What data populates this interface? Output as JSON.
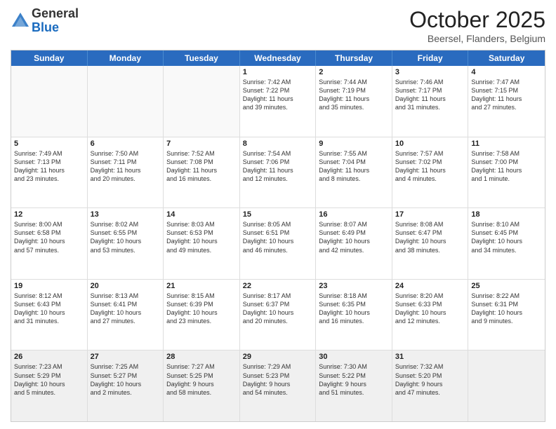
{
  "logo": {
    "general": "General",
    "blue": "Blue"
  },
  "title": "October 2025",
  "location": "Beersel, Flanders, Belgium",
  "days": [
    "Sunday",
    "Monday",
    "Tuesday",
    "Wednesday",
    "Thursday",
    "Friday",
    "Saturday"
  ],
  "weeks": [
    [
      {
        "day": "",
        "info": ""
      },
      {
        "day": "",
        "info": ""
      },
      {
        "day": "",
        "info": ""
      },
      {
        "day": "1",
        "info": "Sunrise: 7:42 AM\nSunset: 7:22 PM\nDaylight: 11 hours\nand 39 minutes."
      },
      {
        "day": "2",
        "info": "Sunrise: 7:44 AM\nSunset: 7:19 PM\nDaylight: 11 hours\nand 35 minutes."
      },
      {
        "day": "3",
        "info": "Sunrise: 7:46 AM\nSunset: 7:17 PM\nDaylight: 11 hours\nand 31 minutes."
      },
      {
        "day": "4",
        "info": "Sunrise: 7:47 AM\nSunset: 7:15 PM\nDaylight: 11 hours\nand 27 minutes."
      }
    ],
    [
      {
        "day": "5",
        "info": "Sunrise: 7:49 AM\nSunset: 7:13 PM\nDaylight: 11 hours\nand 23 minutes."
      },
      {
        "day": "6",
        "info": "Sunrise: 7:50 AM\nSunset: 7:11 PM\nDaylight: 11 hours\nand 20 minutes."
      },
      {
        "day": "7",
        "info": "Sunrise: 7:52 AM\nSunset: 7:08 PM\nDaylight: 11 hours\nand 16 minutes."
      },
      {
        "day": "8",
        "info": "Sunrise: 7:54 AM\nSunset: 7:06 PM\nDaylight: 11 hours\nand 12 minutes."
      },
      {
        "day": "9",
        "info": "Sunrise: 7:55 AM\nSunset: 7:04 PM\nDaylight: 11 hours\nand 8 minutes."
      },
      {
        "day": "10",
        "info": "Sunrise: 7:57 AM\nSunset: 7:02 PM\nDaylight: 11 hours\nand 4 minutes."
      },
      {
        "day": "11",
        "info": "Sunrise: 7:58 AM\nSunset: 7:00 PM\nDaylight: 11 hours\nand 1 minute."
      }
    ],
    [
      {
        "day": "12",
        "info": "Sunrise: 8:00 AM\nSunset: 6:58 PM\nDaylight: 10 hours\nand 57 minutes."
      },
      {
        "day": "13",
        "info": "Sunrise: 8:02 AM\nSunset: 6:55 PM\nDaylight: 10 hours\nand 53 minutes."
      },
      {
        "day": "14",
        "info": "Sunrise: 8:03 AM\nSunset: 6:53 PM\nDaylight: 10 hours\nand 49 minutes."
      },
      {
        "day": "15",
        "info": "Sunrise: 8:05 AM\nSunset: 6:51 PM\nDaylight: 10 hours\nand 46 minutes."
      },
      {
        "day": "16",
        "info": "Sunrise: 8:07 AM\nSunset: 6:49 PM\nDaylight: 10 hours\nand 42 minutes."
      },
      {
        "day": "17",
        "info": "Sunrise: 8:08 AM\nSunset: 6:47 PM\nDaylight: 10 hours\nand 38 minutes."
      },
      {
        "day": "18",
        "info": "Sunrise: 8:10 AM\nSunset: 6:45 PM\nDaylight: 10 hours\nand 34 minutes."
      }
    ],
    [
      {
        "day": "19",
        "info": "Sunrise: 8:12 AM\nSunset: 6:43 PM\nDaylight: 10 hours\nand 31 minutes."
      },
      {
        "day": "20",
        "info": "Sunrise: 8:13 AM\nSunset: 6:41 PM\nDaylight: 10 hours\nand 27 minutes."
      },
      {
        "day": "21",
        "info": "Sunrise: 8:15 AM\nSunset: 6:39 PM\nDaylight: 10 hours\nand 23 minutes."
      },
      {
        "day": "22",
        "info": "Sunrise: 8:17 AM\nSunset: 6:37 PM\nDaylight: 10 hours\nand 20 minutes."
      },
      {
        "day": "23",
        "info": "Sunrise: 8:18 AM\nSunset: 6:35 PM\nDaylight: 10 hours\nand 16 minutes."
      },
      {
        "day": "24",
        "info": "Sunrise: 8:20 AM\nSunset: 6:33 PM\nDaylight: 10 hours\nand 12 minutes."
      },
      {
        "day": "25",
        "info": "Sunrise: 8:22 AM\nSunset: 6:31 PM\nDaylight: 10 hours\nand 9 minutes."
      }
    ],
    [
      {
        "day": "26",
        "info": "Sunrise: 7:23 AM\nSunset: 5:29 PM\nDaylight: 10 hours\nand 5 minutes."
      },
      {
        "day": "27",
        "info": "Sunrise: 7:25 AM\nSunset: 5:27 PM\nDaylight: 10 hours\nand 2 minutes."
      },
      {
        "day": "28",
        "info": "Sunrise: 7:27 AM\nSunset: 5:25 PM\nDaylight: 9 hours\nand 58 minutes."
      },
      {
        "day": "29",
        "info": "Sunrise: 7:29 AM\nSunset: 5:23 PM\nDaylight: 9 hours\nand 54 minutes."
      },
      {
        "day": "30",
        "info": "Sunrise: 7:30 AM\nSunset: 5:22 PM\nDaylight: 9 hours\nand 51 minutes."
      },
      {
        "day": "31",
        "info": "Sunrise: 7:32 AM\nSunset: 5:20 PM\nDaylight: 9 hours\nand 47 minutes."
      },
      {
        "day": "",
        "info": ""
      }
    ]
  ]
}
